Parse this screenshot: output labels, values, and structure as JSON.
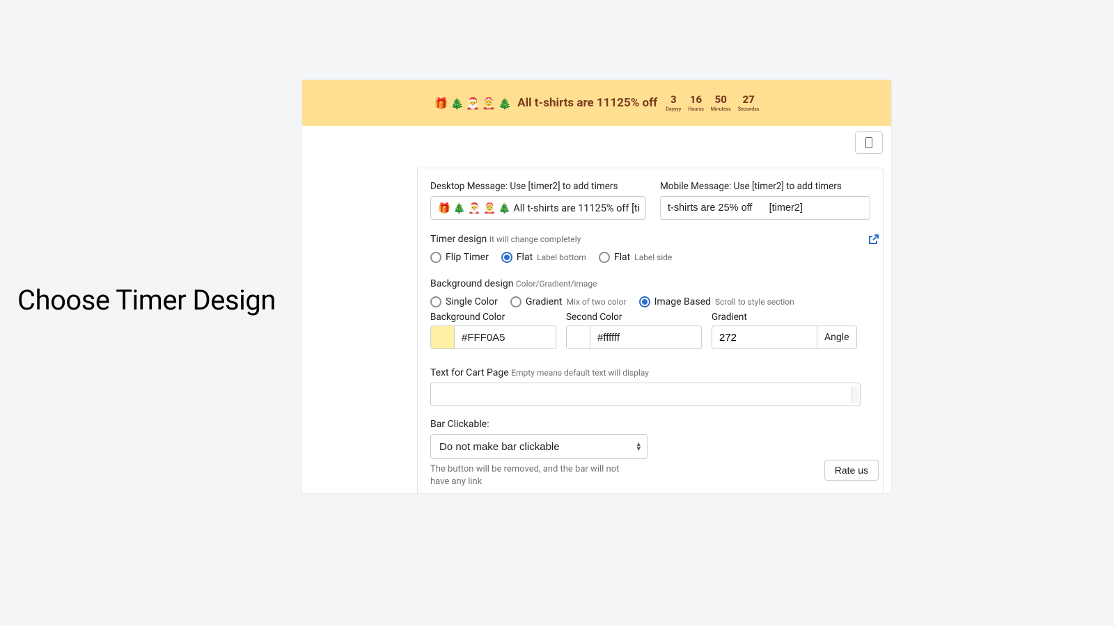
{
  "heading": "Choose Timer Design",
  "banner": {
    "message": "All t-shirts are 11125% off",
    "emojis": [
      "🎁",
      "🎄",
      "🎅",
      "🤶",
      "🎄"
    ],
    "countdown": [
      {
        "num": "3",
        "lab": "Dayyyy"
      },
      {
        "num": "16",
        "lab": "Hourss"
      },
      {
        "num": "50",
        "lab": "Minutess"
      },
      {
        "num": "27",
        "lab": "Secondss"
      }
    ]
  },
  "desktop_msg": {
    "label": "Desktop Message: Use [timer2] to add timers",
    "value": "🎁 🎄 🎅 🤶 🎄 All t-shirts are 11125% off    [ti"
  },
  "mobile_msg": {
    "label": "Mobile Message: Use [timer2] to add timers",
    "value": "t-shirts are 25% off      [timer2]"
  },
  "timer_design": {
    "title": "Timer design",
    "hint": "It will change completely",
    "options": [
      {
        "label": "Flip Timer",
        "hint": "",
        "selected": false
      },
      {
        "label": "Flat",
        "hint": "Label bottom",
        "selected": true
      },
      {
        "label": "Flat",
        "hint": "Label side",
        "selected": false
      }
    ]
  },
  "bg_design": {
    "title": "Background design",
    "hint": "Color/Gradient/image",
    "options": [
      {
        "label": "Single Color",
        "hint": "",
        "selected": false
      },
      {
        "label": "Gradient",
        "hint": "Mix of two color",
        "selected": false
      },
      {
        "label": "Image Based",
        "hint": "Scroll to style section",
        "selected": true
      }
    ]
  },
  "bg_color": {
    "label": "Background Color",
    "value": "#FFF0A5"
  },
  "second_color": {
    "label": "Second Color",
    "value": "#ffffff"
  },
  "gradient": {
    "label": "Gradient",
    "value": "272",
    "suffix": "Angle"
  },
  "cart_text": {
    "label": "Text for Cart Page",
    "hint": "Empty means default text will display"
  },
  "bar_clickable": {
    "label": "Bar Clickable:",
    "value": "Do not make bar clickable",
    "helper": "The button will be removed, and the bar will not have any link"
  },
  "rate_us": "Rate us"
}
